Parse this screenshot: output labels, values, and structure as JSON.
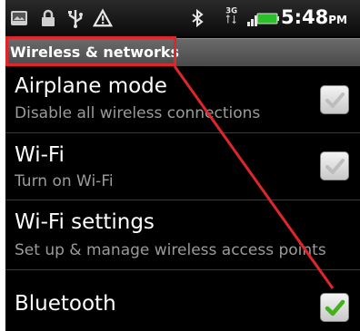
{
  "status_bar": {
    "icons": [
      "image-icon",
      "lock-icon",
      "usb-icon",
      "warning-icon",
      "bluetooth-icon",
      "3g-icon",
      "signal-icon",
      "battery-icon"
    ],
    "network_type": "3G",
    "time": "5:48",
    "ampm": "PM"
  },
  "section": {
    "header": "Wireless & networks"
  },
  "settings": [
    {
      "title": "Airplane mode",
      "summary": "Disable all wireless connections",
      "checkbox": true,
      "checked": false
    },
    {
      "title": "Wi-Fi",
      "summary": "Turn on Wi-Fi",
      "checkbox": true,
      "checked": false
    },
    {
      "title": "Wi-Fi settings",
      "summary": "Set up & manage wireless access points",
      "checkbox": false
    },
    {
      "title": "Bluetooth",
      "summary": "",
      "checkbox": true,
      "checked": true
    }
  ],
  "colors": {
    "annotation_red": "#e0262b",
    "check_green": "#43b21a",
    "check_gray": "#bdbdbd"
  }
}
